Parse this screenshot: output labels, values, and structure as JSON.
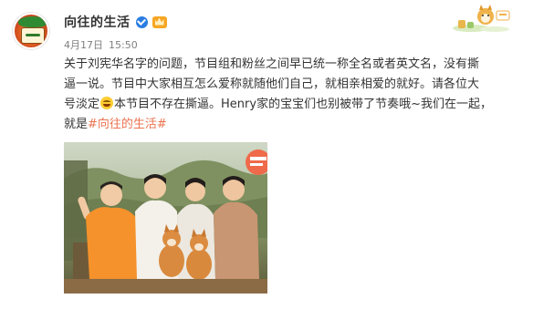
{
  "post": {
    "author": "向往的生活",
    "date": "4月17日",
    "time": "15:50",
    "lines": [
      {
        "text": "关于刘宪华名字的问题，节目组和粉丝之间早已统一称全名或者英文名，没有撕"
      },
      {
        "text": "逼一说。节目中大家相互怎么爱称就随他们自己，就相亲相爱的就好。请各位大"
      },
      {
        "before_emoji": "号淡定",
        "after_emoji": "本节目不存在撕逼。Henry家的宝宝们也别被带了节奏哦~我们在一起，"
      },
      {
        "prefix": "就是",
        "hashtag": "#向往的生活#"
      }
    ]
  },
  "icons": {
    "avatar": "show-logo-avatar",
    "verified": "verified-badge-icon",
    "vip": "vip-crown-icon",
    "emoji": "grinning-sweat-emoji-icon",
    "deco": "shiba-dog-sticker"
  },
  "colors": {
    "hashtag": "#eb7350",
    "verified": "#2a7de1",
    "meta": "#808080"
  }
}
